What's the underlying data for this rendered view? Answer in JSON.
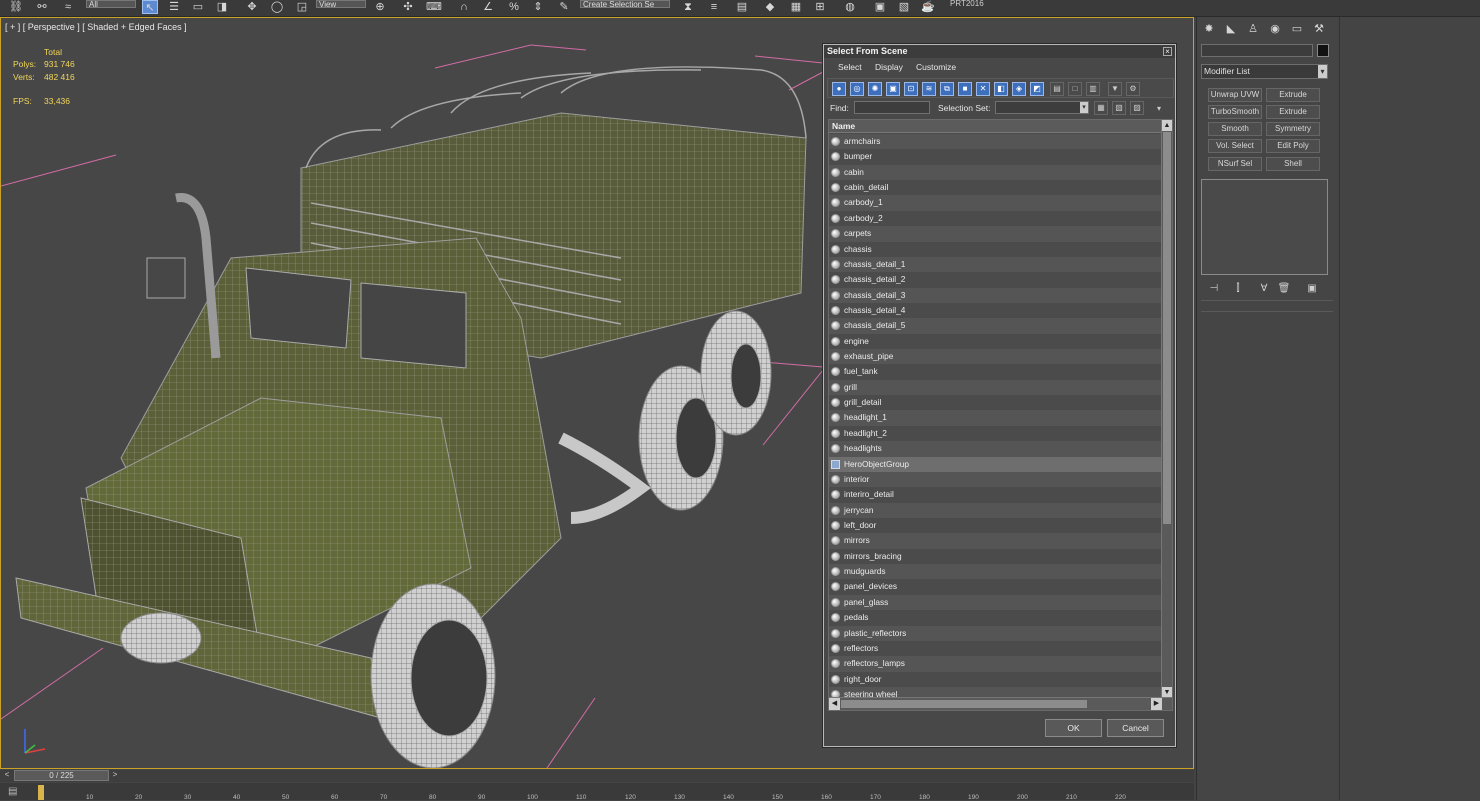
{
  "toolbar": {
    "combo_all": "All",
    "combo_view": "View",
    "combo_selection": "Create Selection Se",
    "right_label": "PRT2016"
  },
  "viewport": {
    "label": "[ + ] [ Perspective ] [ Shaded + Edged Faces ]",
    "stats": {
      "total_label": "Total",
      "polys_label": "Polys:",
      "polys_value": "931 746",
      "verts_label": "Verts:",
      "verts_value": "482 416",
      "fps_label": "FPS:",
      "fps_value": "33,436"
    },
    "truck_color": "#5c5f36",
    "wire_color": "#b9b9b9",
    "bbox_color": "#d26ca6"
  },
  "dialog": {
    "title": "Select From Scene",
    "close": "×",
    "menu": [
      "Select",
      "Display",
      "Customize"
    ],
    "find_label": "Find:",
    "selection_set_label": "Selection Set:",
    "column_name": "Name",
    "items": [
      {
        "name": "armchairs",
        "type": "object"
      },
      {
        "name": "bumper",
        "type": "object"
      },
      {
        "name": "cabin",
        "type": "object"
      },
      {
        "name": "cabin_detail",
        "type": "object"
      },
      {
        "name": "carbody_1",
        "type": "object"
      },
      {
        "name": "carbody_2",
        "type": "object"
      },
      {
        "name": "carpets",
        "type": "object"
      },
      {
        "name": "chassis",
        "type": "object"
      },
      {
        "name": "chassis_detail_1",
        "type": "object"
      },
      {
        "name": "chassis_detail_2",
        "type": "object"
      },
      {
        "name": "chassis_detail_3",
        "type": "object"
      },
      {
        "name": "chassis_detail_4",
        "type": "object"
      },
      {
        "name": "chassis_detail_5",
        "type": "object"
      },
      {
        "name": "engine",
        "type": "object"
      },
      {
        "name": "exhaust_pipe",
        "type": "object"
      },
      {
        "name": "fuel_tank",
        "type": "object"
      },
      {
        "name": "grill",
        "type": "object"
      },
      {
        "name": "grill_detail",
        "type": "object"
      },
      {
        "name": "headlight_1",
        "type": "object"
      },
      {
        "name": "headlight_2",
        "type": "object"
      },
      {
        "name": "headlights",
        "type": "object"
      },
      {
        "name": "HeroObjectGroup",
        "type": "group",
        "selected": true
      },
      {
        "name": "interior",
        "type": "object"
      },
      {
        "name": "interiro_detail",
        "type": "object"
      },
      {
        "name": "jerrycan",
        "type": "object"
      },
      {
        "name": "left_door",
        "type": "object"
      },
      {
        "name": "mirrors",
        "type": "object"
      },
      {
        "name": "mirrors_bracing",
        "type": "object"
      },
      {
        "name": "mudguards",
        "type": "object"
      },
      {
        "name": "panel_devices",
        "type": "object"
      },
      {
        "name": "panel_glass",
        "type": "object"
      },
      {
        "name": "pedals",
        "type": "object"
      },
      {
        "name": "plastic_reflectors",
        "type": "object"
      },
      {
        "name": "reflectors",
        "type": "object"
      },
      {
        "name": "reflectors_lamps",
        "type": "object"
      },
      {
        "name": "right_door",
        "type": "object"
      },
      {
        "name": "steering wheel",
        "type": "object"
      }
    ],
    "ok_label": "OK",
    "cancel_label": "Cancel"
  },
  "command_panel": {
    "modifier_list": "Modifier List",
    "modifiers": [
      [
        "Unwrap UVW",
        "Extrude"
      ],
      [
        "TurboSmooth",
        "Extrude"
      ],
      [
        "Smooth",
        "Symmetry"
      ],
      [
        "Vol. Select",
        "Edit Poly"
      ],
      [
        "NSurf Sel",
        "Shell"
      ]
    ]
  },
  "timeline": {
    "frame_display": "0 / 225",
    "ticks": [
      "10",
      "20",
      "30",
      "40",
      "50",
      "60",
      "70",
      "80",
      "90",
      "100",
      "110",
      "120",
      "130",
      "140",
      "150",
      "160",
      "170",
      "180",
      "190",
      "200",
      "210",
      "220"
    ]
  }
}
